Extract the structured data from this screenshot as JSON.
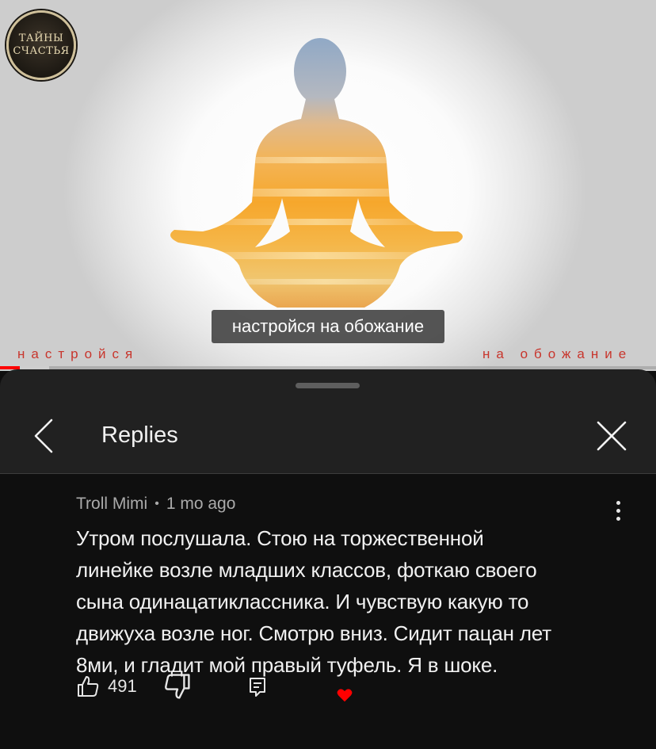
{
  "video": {
    "channel_logo_lines": [
      "ТАЙНЫ",
      "СЧАСТЬЯ"
    ],
    "subtitle": "настройся на обожание",
    "lyric_left": "настройся",
    "lyric_right": "на обожание",
    "progress_fraction": 0.03,
    "buffered_fraction": 0.075,
    "colors": {
      "progress": "#ff0000",
      "lyric": "#c8352c"
    }
  },
  "header": {
    "title": "Replies",
    "back_icon": "chevron-left-icon",
    "close_icon": "close-icon"
  },
  "comment": {
    "author": "Troll Mimi",
    "separator": "•",
    "time": "1 mo ago",
    "text_lines": [
      "Утром послушала. Стою на торжественной",
      "линейке возле младших классов, фоткаю своего",
      "сына одинацатиклассника. И чувствую какую то",
      "движуха возле ног. Смотрю вниз. Сидит пацан лет",
      "8ми, и гладит мой правый туфель. Я в шоке."
    ],
    "likes": "491",
    "icons": [
      "thumb-up-icon",
      "thumb-down-icon",
      "reply-icon",
      "heart-icon",
      "more-vert-icon"
    ],
    "heart_color": "#ff0000"
  }
}
